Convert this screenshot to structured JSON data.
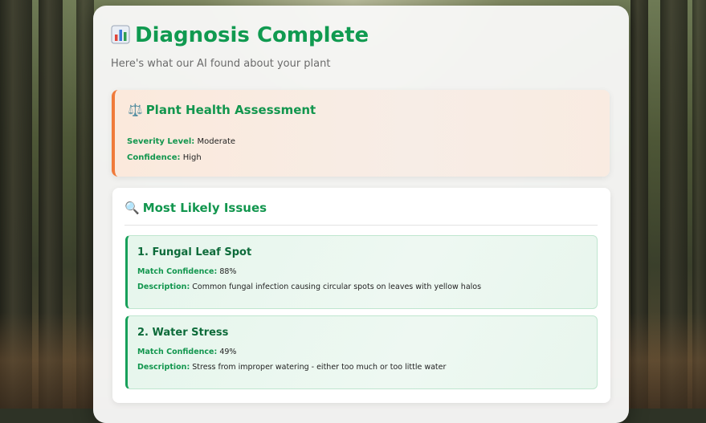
{
  "header": {
    "title": "Diagnosis Complete",
    "subtitle": "Here's what our AI found about your plant"
  },
  "assessment": {
    "title": "Plant Health Assessment",
    "severity_label": "Severity Level:",
    "severity_value": "Moderate",
    "confidence_label": "Confidence:",
    "confidence_value": "High"
  },
  "issues": {
    "title": "Most Likely Issues",
    "items": [
      {
        "name": "1. Fungal Leaf Spot",
        "match_label": "Match Confidence:",
        "match_value": "88%",
        "desc_label": "Description:",
        "desc_value": "Common fungal infection causing circular spots on leaves with yellow halos"
      },
      {
        "name": "2. Water Stress",
        "match_label": "Match Confidence:",
        "match_value": "49%",
        "desc_label": "Description:",
        "desc_value": "Stress from improper watering - either too much or too little water"
      }
    ]
  },
  "icons": {
    "title_icon": "bar-chart-icon",
    "assessment_icon": "balance-scale-icon",
    "issues_icon": "magnifying-glass-icon"
  },
  "colors": {
    "accent_green": "#109a50",
    "assessment_border": "#f07a3a",
    "issue_border": "#17a05a"
  }
}
